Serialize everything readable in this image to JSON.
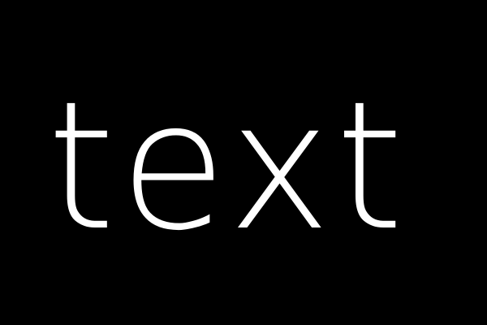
{
  "background_color": "#000000",
  "text_color": "#ffffff",
  "main_text": "text"
}
